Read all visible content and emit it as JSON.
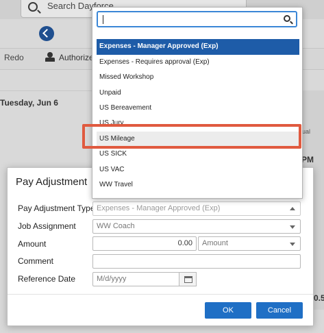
{
  "background": {
    "search_placeholder": "Search Dayforce",
    "toolbar": {
      "redo_label": "Redo",
      "authorize_label": "Authorize"
    },
    "day_header": "Tuesday, Jun 6",
    "right_col": {
      "actual": "ual",
      "pm": "PM",
      "value": "0.5"
    }
  },
  "dropdown": {
    "search_value": "",
    "items": [
      "Expenses - Manager Approved (Exp)",
      "Expenses - Requires approval (Exp)",
      "Missed Workshop",
      "Unpaid",
      "US Bereavement",
      "US Jury",
      "US Mileage",
      "US SICK",
      "US VAC",
      "WW Travel"
    ],
    "selected_index": 0,
    "highlighted_index": 6
  },
  "modal": {
    "title": "Pay Adjustment",
    "fields": {
      "pay_adjustment_type": {
        "label": "Pay Adjustment Type",
        "value": "Expenses - Manager Approved (Exp)"
      },
      "job_assignment": {
        "label": "Job Assignment",
        "value": "WW Coach"
      },
      "amount": {
        "label": "Amount",
        "value": "0.00",
        "unit": "Amount"
      },
      "comment": {
        "label": "Comment",
        "value": ""
      },
      "reference_date": {
        "label": "Reference Date",
        "placeholder": "M/d/yyyy"
      }
    },
    "buttons": {
      "ok": "OK",
      "cancel": "Cancel"
    }
  },
  "colors": {
    "primary": "#1f6fc5",
    "selected_item": "#1e5ca8",
    "annotation": "#e05a3f",
    "search_focus": "#3a86d6"
  }
}
